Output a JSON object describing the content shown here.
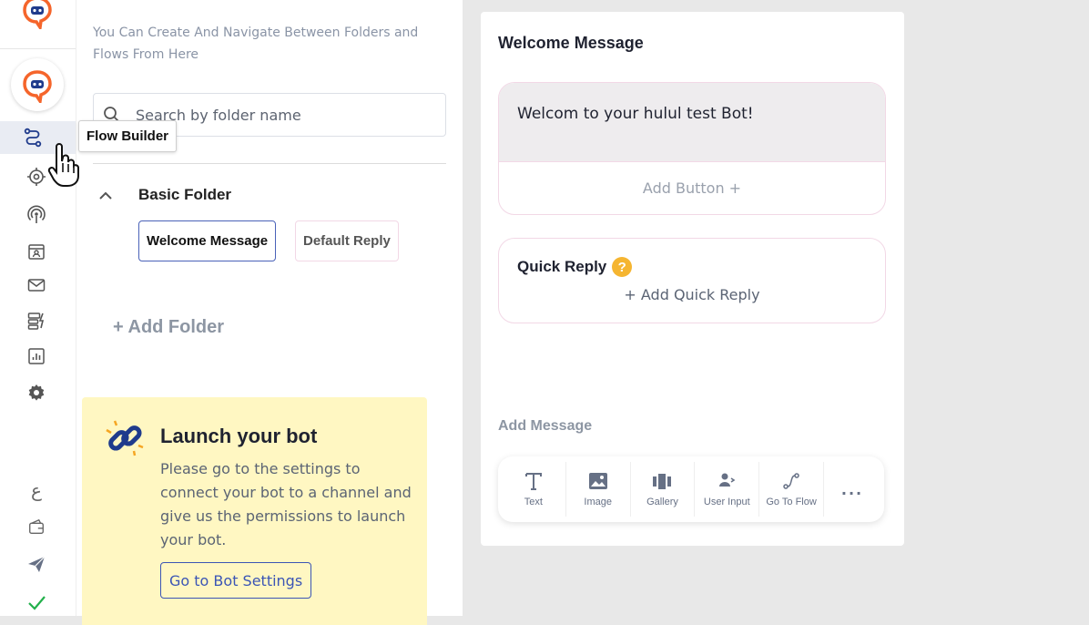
{
  "sidebar": {
    "items": [
      {
        "name": "flow-builder",
        "icon": "flow-icon",
        "active": true
      },
      {
        "name": "ai-settings",
        "icon": "gear-brain-icon"
      },
      {
        "name": "broadcast",
        "icon": "broadcast-icon"
      },
      {
        "name": "contacts",
        "icon": "contact-card-icon"
      },
      {
        "name": "messages",
        "icon": "mail-icon"
      },
      {
        "name": "automation",
        "icon": "lightning-list-icon"
      },
      {
        "name": "analytics",
        "icon": "bar-chart-icon"
      },
      {
        "name": "settings",
        "icon": "cog-icon"
      },
      {
        "name": "language",
        "icon": "arabic-letter-icon",
        "glyph": "ع"
      },
      {
        "name": "wallet",
        "icon": "wallet-icon"
      },
      {
        "name": "send",
        "icon": "paper-plane-icon"
      },
      {
        "name": "status",
        "icon": "checkmark-icon"
      }
    ],
    "tooltip": "Flow Builder"
  },
  "folders_panel": {
    "intro": "You Can Create And Navigate Between Folders and Flows From Here",
    "search_placeholder": "Search by folder name",
    "folder": {
      "title": "Basic Folder",
      "flows": [
        "Welcome Message",
        "Default Reply"
      ]
    },
    "add_folder": "+ Add Folder"
  },
  "launch_card": {
    "title": "Launch your bot",
    "description": "Please go to the settings to connect your bot to a channel and give us the permissions to launch your bot.",
    "button": "Go to Bot Settings"
  },
  "editor": {
    "title": "Welcome Message",
    "message_text": "Welcom to your hulul test Bot!",
    "add_button": "Add Button +",
    "quick_reply": {
      "title": "Quick Reply",
      "help": "?",
      "add": "+ Add Quick Reply"
    },
    "add_message_label": "Add Message",
    "tools": [
      "Text",
      "Image",
      "Gallery",
      "User Input",
      "Go To Flow"
    ],
    "more": "..."
  },
  "colors": {
    "brand_orange": "#f5652b",
    "brand_navy": "#1f3b8c",
    "accent_blue": "#3b55b5",
    "launch_bg": "#fff7c2",
    "success_green": "#22b04b"
  }
}
